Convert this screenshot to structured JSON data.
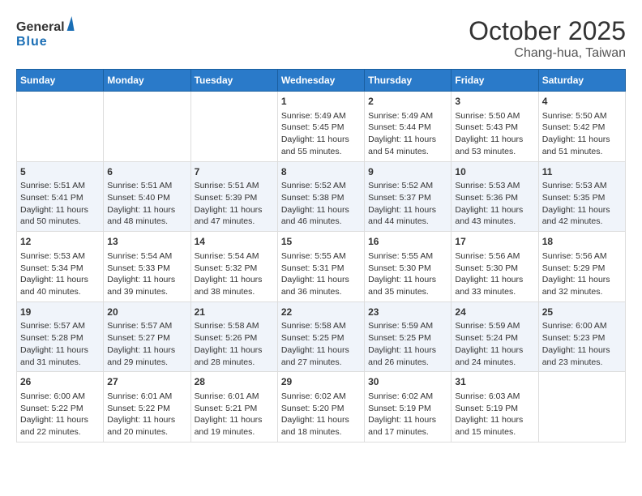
{
  "logo": {
    "line1": "General",
    "line2": "Blue"
  },
  "title": "October 2025",
  "location": "Chang-hua, Taiwan",
  "days_of_week": [
    "Sunday",
    "Monday",
    "Tuesday",
    "Wednesday",
    "Thursday",
    "Friday",
    "Saturday"
  ],
  "weeks": [
    [
      {
        "day": "",
        "content": ""
      },
      {
        "day": "",
        "content": ""
      },
      {
        "day": "",
        "content": ""
      },
      {
        "day": "1",
        "content": "Sunrise: 5:49 AM\nSunset: 5:45 PM\nDaylight: 11 hours\nand 55 minutes."
      },
      {
        "day": "2",
        "content": "Sunrise: 5:49 AM\nSunset: 5:44 PM\nDaylight: 11 hours\nand 54 minutes."
      },
      {
        "day": "3",
        "content": "Sunrise: 5:50 AM\nSunset: 5:43 PM\nDaylight: 11 hours\nand 53 minutes."
      },
      {
        "day": "4",
        "content": "Sunrise: 5:50 AM\nSunset: 5:42 PM\nDaylight: 11 hours\nand 51 minutes."
      }
    ],
    [
      {
        "day": "5",
        "content": "Sunrise: 5:51 AM\nSunset: 5:41 PM\nDaylight: 11 hours\nand 50 minutes."
      },
      {
        "day": "6",
        "content": "Sunrise: 5:51 AM\nSunset: 5:40 PM\nDaylight: 11 hours\nand 48 minutes."
      },
      {
        "day": "7",
        "content": "Sunrise: 5:51 AM\nSunset: 5:39 PM\nDaylight: 11 hours\nand 47 minutes."
      },
      {
        "day": "8",
        "content": "Sunrise: 5:52 AM\nSunset: 5:38 PM\nDaylight: 11 hours\nand 46 minutes."
      },
      {
        "day": "9",
        "content": "Sunrise: 5:52 AM\nSunset: 5:37 PM\nDaylight: 11 hours\nand 44 minutes."
      },
      {
        "day": "10",
        "content": "Sunrise: 5:53 AM\nSunset: 5:36 PM\nDaylight: 11 hours\nand 43 minutes."
      },
      {
        "day": "11",
        "content": "Sunrise: 5:53 AM\nSunset: 5:35 PM\nDaylight: 11 hours\nand 42 minutes."
      }
    ],
    [
      {
        "day": "12",
        "content": "Sunrise: 5:53 AM\nSunset: 5:34 PM\nDaylight: 11 hours\nand 40 minutes."
      },
      {
        "day": "13",
        "content": "Sunrise: 5:54 AM\nSunset: 5:33 PM\nDaylight: 11 hours\nand 39 minutes."
      },
      {
        "day": "14",
        "content": "Sunrise: 5:54 AM\nSunset: 5:32 PM\nDaylight: 11 hours\nand 38 minutes."
      },
      {
        "day": "15",
        "content": "Sunrise: 5:55 AM\nSunset: 5:31 PM\nDaylight: 11 hours\nand 36 minutes."
      },
      {
        "day": "16",
        "content": "Sunrise: 5:55 AM\nSunset: 5:30 PM\nDaylight: 11 hours\nand 35 minutes."
      },
      {
        "day": "17",
        "content": "Sunrise: 5:56 AM\nSunset: 5:30 PM\nDaylight: 11 hours\nand 33 minutes."
      },
      {
        "day": "18",
        "content": "Sunrise: 5:56 AM\nSunset: 5:29 PM\nDaylight: 11 hours\nand 32 minutes."
      }
    ],
    [
      {
        "day": "19",
        "content": "Sunrise: 5:57 AM\nSunset: 5:28 PM\nDaylight: 11 hours\nand 31 minutes."
      },
      {
        "day": "20",
        "content": "Sunrise: 5:57 AM\nSunset: 5:27 PM\nDaylight: 11 hours\nand 29 minutes."
      },
      {
        "day": "21",
        "content": "Sunrise: 5:58 AM\nSunset: 5:26 PM\nDaylight: 11 hours\nand 28 minutes."
      },
      {
        "day": "22",
        "content": "Sunrise: 5:58 AM\nSunset: 5:25 PM\nDaylight: 11 hours\nand 27 minutes."
      },
      {
        "day": "23",
        "content": "Sunrise: 5:59 AM\nSunset: 5:25 PM\nDaylight: 11 hours\nand 26 minutes."
      },
      {
        "day": "24",
        "content": "Sunrise: 5:59 AM\nSunset: 5:24 PM\nDaylight: 11 hours\nand 24 minutes."
      },
      {
        "day": "25",
        "content": "Sunrise: 6:00 AM\nSunset: 5:23 PM\nDaylight: 11 hours\nand 23 minutes."
      }
    ],
    [
      {
        "day": "26",
        "content": "Sunrise: 6:00 AM\nSunset: 5:22 PM\nDaylight: 11 hours\nand 22 minutes."
      },
      {
        "day": "27",
        "content": "Sunrise: 6:01 AM\nSunset: 5:22 PM\nDaylight: 11 hours\nand 20 minutes."
      },
      {
        "day": "28",
        "content": "Sunrise: 6:01 AM\nSunset: 5:21 PM\nDaylight: 11 hours\nand 19 minutes."
      },
      {
        "day": "29",
        "content": "Sunrise: 6:02 AM\nSunset: 5:20 PM\nDaylight: 11 hours\nand 18 minutes."
      },
      {
        "day": "30",
        "content": "Sunrise: 6:02 AM\nSunset: 5:19 PM\nDaylight: 11 hours\nand 17 minutes."
      },
      {
        "day": "31",
        "content": "Sunrise: 6:03 AM\nSunset: 5:19 PM\nDaylight: 11 hours\nand 15 minutes."
      },
      {
        "day": "",
        "content": ""
      }
    ]
  ]
}
